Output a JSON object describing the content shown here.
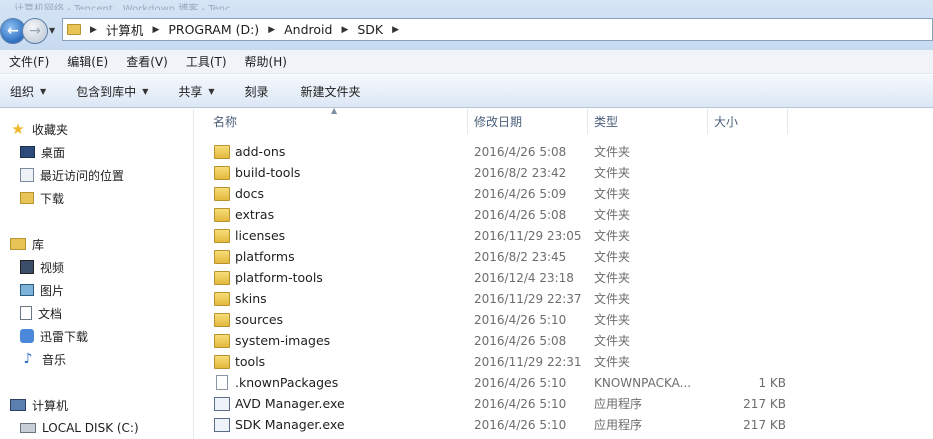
{
  "window": {
    "background_tabs": [
      "计算机网络 - Tencent",
      "Workdown 博客 - Tenc"
    ]
  },
  "address_bar": {
    "crumbs": [
      "计算机",
      "PROGRAM (D:)",
      "Android",
      "SDK"
    ]
  },
  "menu": [
    "文件(F)",
    "编辑(E)",
    "查看(V)",
    "工具(T)",
    "帮助(H)"
  ],
  "toolbar": {
    "organize": "组织",
    "include_in_library": "包含到库中",
    "share": "共享",
    "burn": "刻录",
    "new_folder": "新建文件夹"
  },
  "nav": {
    "favorites": "收藏夹",
    "desktop": "桌面",
    "recent": "最近访问的位置",
    "downloads": "下载",
    "libraries": "库",
    "videos": "视频",
    "pictures": "图片",
    "documents": "文档",
    "thunder": "迅雷下载",
    "music": "音乐",
    "computer": "计算机",
    "local_disk": "LOCAL DISK (C:)"
  },
  "columns": {
    "name": "名称",
    "date": "修改日期",
    "type": "类型",
    "size": "大小"
  },
  "files": [
    {
      "name": "add-ons",
      "date": "2016/4/26 5:08",
      "type": "文件夹",
      "size": "",
      "icon": "folder"
    },
    {
      "name": "build-tools",
      "date": "2016/8/2 23:42",
      "type": "文件夹",
      "size": "",
      "icon": "folder"
    },
    {
      "name": "docs",
      "date": "2016/4/26 5:09",
      "type": "文件夹",
      "size": "",
      "icon": "folder"
    },
    {
      "name": "extras",
      "date": "2016/4/26 5:08",
      "type": "文件夹",
      "size": "",
      "icon": "folder"
    },
    {
      "name": "licenses",
      "date": "2016/11/29 23:05",
      "type": "文件夹",
      "size": "",
      "icon": "folder"
    },
    {
      "name": "platforms",
      "date": "2016/8/2 23:45",
      "type": "文件夹",
      "size": "",
      "icon": "folder"
    },
    {
      "name": "platform-tools",
      "date": "2016/12/4 23:18",
      "type": "文件夹",
      "size": "",
      "icon": "folder"
    },
    {
      "name": "skins",
      "date": "2016/11/29 22:37",
      "type": "文件夹",
      "size": "",
      "icon": "folder"
    },
    {
      "name": "sources",
      "date": "2016/4/26 5:10",
      "type": "文件夹",
      "size": "",
      "icon": "folder"
    },
    {
      "name": "system-images",
      "date": "2016/4/26 5:08",
      "type": "文件夹",
      "size": "",
      "icon": "folder"
    },
    {
      "name": "tools",
      "date": "2016/11/29 22:31",
      "type": "文件夹",
      "size": "",
      "icon": "folder"
    },
    {
      "name": ".knownPackages",
      "date": "2016/4/26 5:10",
      "type": "KNOWNPACKA...",
      "size": "1 KB",
      "icon": "file"
    },
    {
      "name": "AVD Manager.exe",
      "date": "2016/4/26 5:10",
      "type": "应用程序",
      "size": "217 KB",
      "icon": "exe"
    },
    {
      "name": "SDK Manager.exe",
      "date": "2016/4/26 5:10",
      "type": "应用程序",
      "size": "217 KB",
      "icon": "exe"
    }
  ]
}
